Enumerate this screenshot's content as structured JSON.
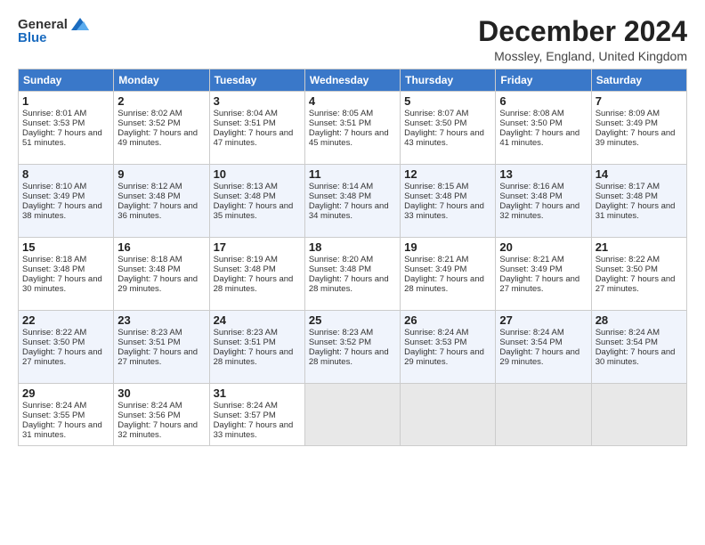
{
  "logo": {
    "general": "General",
    "blue": "Blue"
  },
  "title": "December 2024",
  "subtitle": "Mossley, England, United Kingdom",
  "headers": [
    "Sunday",
    "Monday",
    "Tuesday",
    "Wednesday",
    "Thursday",
    "Friday",
    "Saturday"
  ],
  "weeks": [
    [
      {
        "day": "1",
        "sunrise": "Sunrise: 8:01 AM",
        "sunset": "Sunset: 3:53 PM",
        "daylight": "Daylight: 7 hours and 51 minutes."
      },
      {
        "day": "2",
        "sunrise": "Sunrise: 8:02 AM",
        "sunset": "Sunset: 3:52 PM",
        "daylight": "Daylight: 7 hours and 49 minutes."
      },
      {
        "day": "3",
        "sunrise": "Sunrise: 8:04 AM",
        "sunset": "Sunset: 3:51 PM",
        "daylight": "Daylight: 7 hours and 47 minutes."
      },
      {
        "day": "4",
        "sunrise": "Sunrise: 8:05 AM",
        "sunset": "Sunset: 3:51 PM",
        "daylight": "Daylight: 7 hours and 45 minutes."
      },
      {
        "day": "5",
        "sunrise": "Sunrise: 8:07 AM",
        "sunset": "Sunset: 3:50 PM",
        "daylight": "Daylight: 7 hours and 43 minutes."
      },
      {
        "day": "6",
        "sunrise": "Sunrise: 8:08 AM",
        "sunset": "Sunset: 3:50 PM",
        "daylight": "Daylight: 7 hours and 41 minutes."
      },
      {
        "day": "7",
        "sunrise": "Sunrise: 8:09 AM",
        "sunset": "Sunset: 3:49 PM",
        "daylight": "Daylight: 7 hours and 39 minutes."
      }
    ],
    [
      {
        "day": "8",
        "sunrise": "Sunrise: 8:10 AM",
        "sunset": "Sunset: 3:49 PM",
        "daylight": "Daylight: 7 hours and 38 minutes."
      },
      {
        "day": "9",
        "sunrise": "Sunrise: 8:12 AM",
        "sunset": "Sunset: 3:48 PM",
        "daylight": "Daylight: 7 hours and 36 minutes."
      },
      {
        "day": "10",
        "sunrise": "Sunrise: 8:13 AM",
        "sunset": "Sunset: 3:48 PM",
        "daylight": "Daylight: 7 hours and 35 minutes."
      },
      {
        "day": "11",
        "sunrise": "Sunrise: 8:14 AM",
        "sunset": "Sunset: 3:48 PM",
        "daylight": "Daylight: 7 hours and 34 minutes."
      },
      {
        "day": "12",
        "sunrise": "Sunrise: 8:15 AM",
        "sunset": "Sunset: 3:48 PM",
        "daylight": "Daylight: 7 hours and 33 minutes."
      },
      {
        "day": "13",
        "sunrise": "Sunrise: 8:16 AM",
        "sunset": "Sunset: 3:48 PM",
        "daylight": "Daylight: 7 hours and 32 minutes."
      },
      {
        "day": "14",
        "sunrise": "Sunrise: 8:17 AM",
        "sunset": "Sunset: 3:48 PM",
        "daylight": "Daylight: 7 hours and 31 minutes."
      }
    ],
    [
      {
        "day": "15",
        "sunrise": "Sunrise: 8:18 AM",
        "sunset": "Sunset: 3:48 PM",
        "daylight": "Daylight: 7 hours and 30 minutes."
      },
      {
        "day": "16",
        "sunrise": "Sunrise: 8:18 AM",
        "sunset": "Sunset: 3:48 PM",
        "daylight": "Daylight: 7 hours and 29 minutes."
      },
      {
        "day": "17",
        "sunrise": "Sunrise: 8:19 AM",
        "sunset": "Sunset: 3:48 PM",
        "daylight": "Daylight: 7 hours and 28 minutes."
      },
      {
        "day": "18",
        "sunrise": "Sunrise: 8:20 AM",
        "sunset": "Sunset: 3:48 PM",
        "daylight": "Daylight: 7 hours and 28 minutes."
      },
      {
        "day": "19",
        "sunrise": "Sunrise: 8:21 AM",
        "sunset": "Sunset: 3:49 PM",
        "daylight": "Daylight: 7 hours and 28 minutes."
      },
      {
        "day": "20",
        "sunrise": "Sunrise: 8:21 AM",
        "sunset": "Sunset: 3:49 PM",
        "daylight": "Daylight: 7 hours and 27 minutes."
      },
      {
        "day": "21",
        "sunrise": "Sunrise: 8:22 AM",
        "sunset": "Sunset: 3:50 PM",
        "daylight": "Daylight: 7 hours and 27 minutes."
      }
    ],
    [
      {
        "day": "22",
        "sunrise": "Sunrise: 8:22 AM",
        "sunset": "Sunset: 3:50 PM",
        "daylight": "Daylight: 7 hours and 27 minutes."
      },
      {
        "day": "23",
        "sunrise": "Sunrise: 8:23 AM",
        "sunset": "Sunset: 3:51 PM",
        "daylight": "Daylight: 7 hours and 27 minutes."
      },
      {
        "day": "24",
        "sunrise": "Sunrise: 8:23 AM",
        "sunset": "Sunset: 3:51 PM",
        "daylight": "Daylight: 7 hours and 28 minutes."
      },
      {
        "day": "25",
        "sunrise": "Sunrise: 8:23 AM",
        "sunset": "Sunset: 3:52 PM",
        "daylight": "Daylight: 7 hours and 28 minutes."
      },
      {
        "day": "26",
        "sunrise": "Sunrise: 8:24 AM",
        "sunset": "Sunset: 3:53 PM",
        "daylight": "Daylight: 7 hours and 29 minutes."
      },
      {
        "day": "27",
        "sunrise": "Sunrise: 8:24 AM",
        "sunset": "Sunset: 3:54 PM",
        "daylight": "Daylight: 7 hours and 29 minutes."
      },
      {
        "day": "28",
        "sunrise": "Sunrise: 8:24 AM",
        "sunset": "Sunset: 3:54 PM",
        "daylight": "Daylight: 7 hours and 30 minutes."
      }
    ],
    [
      {
        "day": "29",
        "sunrise": "Sunrise: 8:24 AM",
        "sunset": "Sunset: 3:55 PM",
        "daylight": "Daylight: 7 hours and 31 minutes."
      },
      {
        "day": "30",
        "sunrise": "Sunrise: 8:24 AM",
        "sunset": "Sunset: 3:56 PM",
        "daylight": "Daylight: 7 hours and 32 minutes."
      },
      {
        "day": "31",
        "sunrise": "Sunrise: 8:24 AM",
        "sunset": "Sunset: 3:57 PM",
        "daylight": "Daylight: 7 hours and 33 minutes."
      },
      null,
      null,
      null,
      null
    ]
  ]
}
